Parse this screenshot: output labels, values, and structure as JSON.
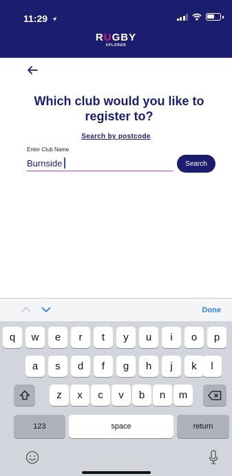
{
  "status_bar": {
    "time": "11:29"
  },
  "header": {
    "logo_main_pre": "R",
    "logo_main_u": "U",
    "logo_main_post": "GBY",
    "logo_sub": "XPLORER"
  },
  "page": {
    "title": "Which club would you like to register to?",
    "postcode_link": "Search by postcode"
  },
  "form": {
    "label": "Enter Club Name",
    "value": "Burnside",
    "search_button": "Search"
  },
  "keyboard": {
    "done": "Done",
    "row1": [
      "q",
      "w",
      "e",
      "r",
      "t",
      "y",
      "u",
      "i",
      "o",
      "p"
    ],
    "row2": [
      "a",
      "s",
      "d",
      "f",
      "g",
      "h",
      "j",
      "k",
      "l"
    ],
    "row3": [
      "z",
      "x",
      "c",
      "v",
      "b",
      "n",
      "m"
    ],
    "numbers_key": "123",
    "space_key": "space",
    "return_key": "return"
  },
  "colors": {
    "brand_navy": "#1b1d6e",
    "accent_magenta": "#c93ac9",
    "ios_blue": "#2f7de1"
  }
}
